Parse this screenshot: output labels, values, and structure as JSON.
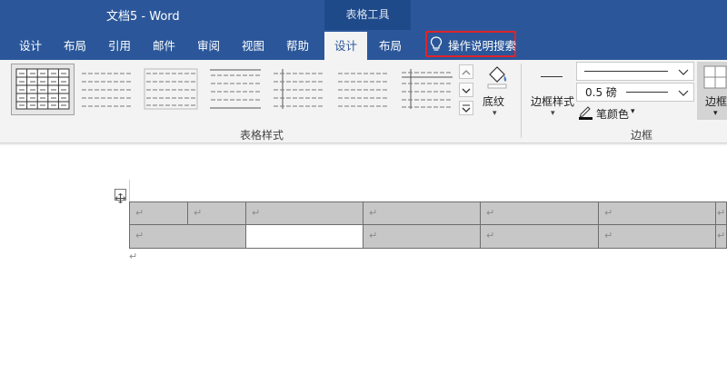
{
  "window": {
    "title": "文档5  -  Word",
    "context_tab_group": "表格工具"
  },
  "tabs": [
    {
      "label": "设计"
    },
    {
      "label": "布局"
    },
    {
      "label": "引用"
    },
    {
      "label": "邮件"
    },
    {
      "label": "审阅"
    },
    {
      "label": "视图"
    },
    {
      "label": "帮助"
    },
    {
      "label": "设计",
      "active": true
    },
    {
      "label": "布局"
    }
  ],
  "tell_me": {
    "text": "操作说明搜索",
    "highlight_color": "#e0232b"
  },
  "ribbon": {
    "table_styles": {
      "group_label": "表格样式",
      "gallery_count": 7,
      "selected_index": 0,
      "shading_label": "底纹"
    },
    "borders": {
      "group_label": "边框",
      "border_styles_label": "边框样式",
      "line_weight": "0.5 磅",
      "pen_color_label": "笔颜色",
      "borders_label": "边框"
    }
  },
  "document": {
    "paragraph_mark": "↵"
  },
  "colors": {
    "title_bar": "#2b579a",
    "context_group": "#1f4a8a",
    "ribbon_bg": "#f3f3f3",
    "cell_shading": "#c7c7c7"
  }
}
